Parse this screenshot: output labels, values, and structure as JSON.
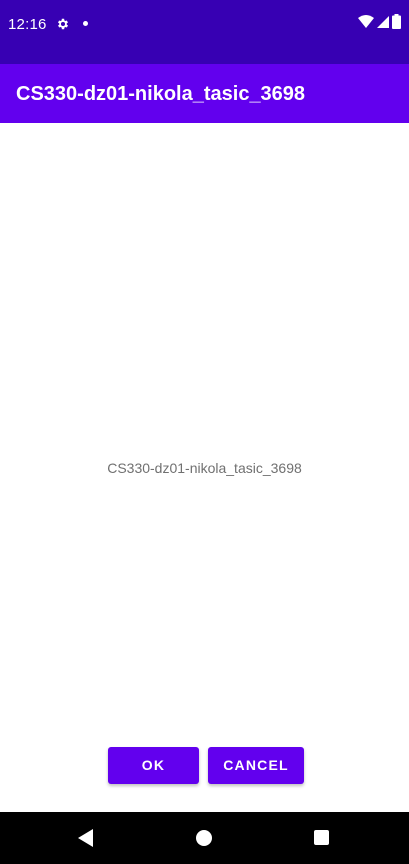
{
  "status_bar": {
    "time": "12:16",
    "icons": [
      "settings-gear-icon",
      "notification-dot-icon",
      "wifi-icon",
      "cell-signal-icon",
      "battery-icon"
    ]
  },
  "app_bar": {
    "title": "CS330-dz01-nikola_tasic_3698"
  },
  "main": {
    "message": "CS330-dz01-nikola_tasic_3698"
  },
  "buttons": {
    "ok_label": "OK",
    "cancel_label": "CANCEL"
  },
  "nav_bar": {
    "icons": [
      "back-icon",
      "home-icon",
      "recents-icon"
    ]
  },
  "colors": {
    "status_bar": "#3700B3",
    "app_bar": "#6200EE",
    "button": "#6200EE",
    "nav_bar": "#000000",
    "message_text": "#707070"
  }
}
